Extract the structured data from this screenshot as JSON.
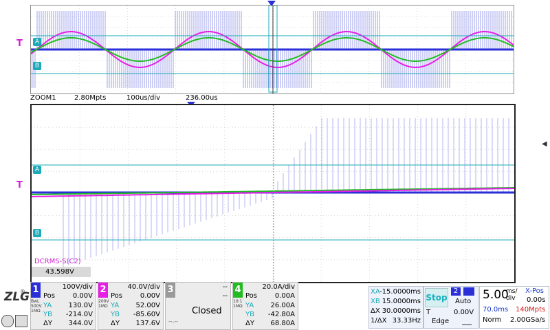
{
  "colors": {
    "ch1": "#2a2fd8",
    "ch2": "#e61ee6",
    "ch4": "#22bb22",
    "cursor": "#1aaab8",
    "trig": "#d21fd2"
  },
  "overview": {
    "channel_markers": [
      "A",
      "B"
    ],
    "trigger_label": "T"
  },
  "zoom_info": {
    "name": "ZOOM1",
    "points": "2.80Mpts",
    "timebase": "100us/div",
    "offset": "236.00us"
  },
  "zoom": {
    "channel_markers": [
      "A",
      "B"
    ],
    "trigger_label": "T"
  },
  "measurement": {
    "name": "DCRMS-S(C2)",
    "value": "43.598V"
  },
  "channels": [
    {
      "num": "1",
      "scale": "100V/div",
      "pos_k": "Pos",
      "pos_v": "0.00V",
      "ya_k": "YA",
      "ya_v": "130.0V",
      "yb_k": "YB",
      "yb_v": "-214.0V",
      "dy_k": "ΔY",
      "dy_v": "344.0V",
      "side": "BwL 500V 1MΩ"
    },
    {
      "num": "2",
      "scale": "40.0V/div",
      "pos_k": "Pos",
      "pos_v": "0.00V",
      "ya_k": "YA",
      "ya_v": "52.00V",
      "yb_k": "YB",
      "yb_v": "-85.60V",
      "dy_k": "ΔY",
      "dy_v": "137.6V",
      "side": "200V 1MΩ"
    },
    {
      "num": "3",
      "scale": "--",
      "pos_v": "--",
      "status": "Closed",
      "foot": "--.--"
    },
    {
      "num": "4",
      "scale": "20.0A/div",
      "pos_k": "Pos",
      "pos_v": "0.00A",
      "ya_k": "YA",
      "ya_v": "26.00A",
      "yb_k": "YB",
      "yb_v": "-42.80A",
      "dy_k": "ΔY",
      "dy_v": "68.80A",
      "side": "10:1 1MΩ"
    }
  ],
  "cursor_panel": {
    "xa_k": "XA",
    "xa_v": "-15.0000ms",
    "xb_k": "XB",
    "xb_v": "15.0000ms",
    "dx_k": "ΔX",
    "dx_v": "30.0000ms",
    "inv_k": "1/ΔX",
    "inv_v": "33.33Hz"
  },
  "trigger_panel": {
    "state": "Stop",
    "source": "2",
    "mode": "Auto",
    "t_k": "T",
    "t_v": "0.00V",
    "type": "Edge"
  },
  "timebase_panel": {
    "value": "5.00",
    "unit_top": "ms/",
    "unit_bot": "div",
    "xpos_k": "X-Pos",
    "xpos_v": "0.00s",
    "window": "70.0ms",
    "mem": "140Mpts",
    "acq": "Norm",
    "rate": "2.00GSa/s"
  }
}
